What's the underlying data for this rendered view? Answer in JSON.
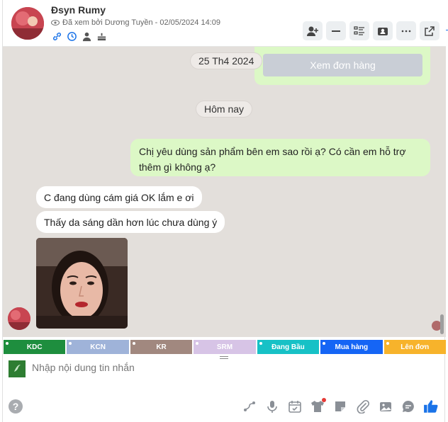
{
  "header": {
    "name": "Đsyn Rumy",
    "seen_text": "Đã xem bởi Dương Tuyền - 02/05/2024 14:09"
  },
  "messages": {
    "order_button": "Xem đơn hàng",
    "date_old": "25 Th4 2024",
    "date_today": "Hôm nay",
    "outgoing_1": "Chị yêu dùng sản phẩm bên em sao rồi ạ? Có cần em hỗ trợ thêm gì không ạ?",
    "incoming_1": "C đang dùng cám giá OK lắm e ơi",
    "incoming_2": "Thấy da sáng dần hơn lúc chưa dùng ý"
  },
  "tags": [
    {
      "label": "KDC",
      "color": "#1e8e3e"
    },
    {
      "label": "KCN",
      "color": "#9fb3d9"
    },
    {
      "label": "KR",
      "color": "#a1887f"
    },
    {
      "label": "SRM",
      "color": "#d7c4e6"
    },
    {
      "label": "Đang Bầu",
      "color": "#17c1c6"
    },
    {
      "label": "Mua hàng",
      "color": "#1565f5"
    },
    {
      "label": "Lên đơn",
      "color": "#f7b32b"
    }
  ],
  "composer": {
    "placeholder": "Nhập nội dung tin nhắn",
    "help_label": "?"
  },
  "colors": {
    "chat_bg": "#e3dfdb",
    "outgoing_bubble": "#dcf8c6",
    "accent": "#1a73e8"
  }
}
